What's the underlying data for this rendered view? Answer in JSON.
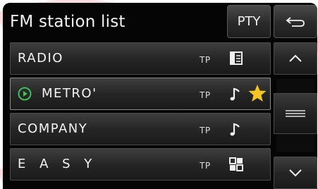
{
  "header": {
    "title": "FM station list",
    "pty_label": "PTY",
    "back_icon": "back-arrow-icon"
  },
  "stations": [
    {
      "name": "RADIO",
      "tp": "TP",
      "icon": "text-info-icon",
      "playing": false,
      "favorite": false
    },
    {
      "name": "METRO'",
      "tp": "TP",
      "icon": "music-note-icon",
      "playing": true,
      "favorite": true
    },
    {
      "name": "COMPANY",
      "tp": "TP",
      "icon": "music-note-icon",
      "playing": false,
      "favorite": false
    },
    {
      "name": "E A S Y",
      "tp": "TP",
      "icon": "grid-icon",
      "playing": false,
      "favorite": false
    }
  ],
  "scroll": {
    "up_icon": "chevron-up-icon",
    "thumb_icon": "menu-lines-icon",
    "down_icon": "chevron-down-icon"
  },
  "colors": {
    "background": "#050505",
    "text": "#f4f4f4",
    "favorite_star": "#f3c623",
    "playing_icon": "#3fbf5a",
    "watermark": "#f4c6cf"
  }
}
